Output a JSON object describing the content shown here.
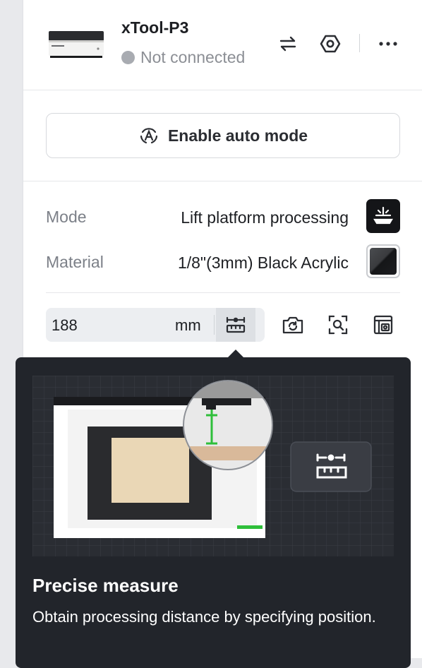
{
  "device": {
    "name": "xTool-P3",
    "status": "Not connected",
    "status_color": "#a8abb1"
  },
  "header_icons": [
    "switch-arrows-icon",
    "settings-hex-icon",
    "more-dots-icon"
  ],
  "auto_mode": {
    "label": "Enable auto mode",
    "icon": "auto-mode-icon"
  },
  "settings": {
    "mode": {
      "label": "Mode",
      "value": "Lift platform processing",
      "icon": "lift-platform-icon"
    },
    "material": {
      "label": "Material",
      "value": "1/8\"(3mm) Black Acrylic",
      "swatch_color": "#2a2b2e"
    }
  },
  "distance": {
    "value": "188",
    "unit": "mm",
    "tool_icons": [
      "measure-ruler-icon",
      "camera-refresh-icon",
      "focus-scan-icon",
      "frame-icon"
    ]
  },
  "tooltip": {
    "title": "Precise measure",
    "description": "Obtain processing distance by specifying position.",
    "background": "#22252b"
  },
  "colors": {
    "accent_green": "#2fbf3a",
    "panel_bg": "#ffffff",
    "page_bg": "#e8e9ec"
  }
}
